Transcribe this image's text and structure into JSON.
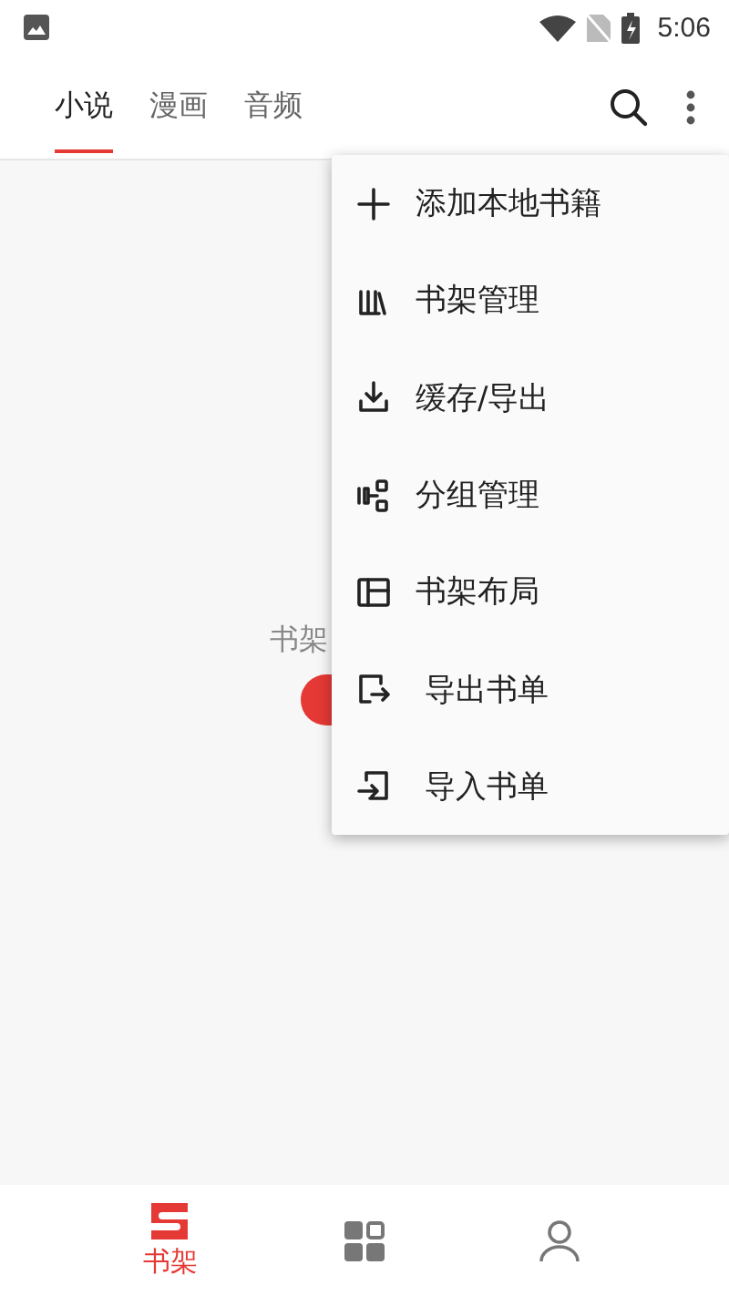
{
  "status_bar": {
    "time": "5:06"
  },
  "tabs": [
    {
      "label": "小说",
      "selected": true
    },
    {
      "label": "漫画",
      "selected": false
    },
    {
      "label": "音频",
      "selected": false
    }
  ],
  "empty_state": {
    "text": "书架"
  },
  "menu": {
    "items": [
      {
        "label": "添加本地书籍"
      },
      {
        "label": "书架管理"
      },
      {
        "label": "缓存/导出"
      },
      {
        "label": "分组管理"
      },
      {
        "label": "书架布局"
      },
      {
        "label": "导出书单"
      },
      {
        "label": "导入书单"
      }
    ]
  },
  "bottom_nav": [
    {
      "label": "书架",
      "selected": true
    },
    {
      "selected": false
    },
    {
      "selected": false
    }
  ]
}
